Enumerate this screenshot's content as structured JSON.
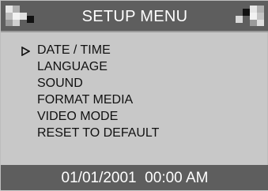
{
  "header": {
    "title": "SETUP MENU",
    "left_icon": "checker-pattern-icon",
    "right_icon": "checker-pattern-icon"
  },
  "menu": {
    "selected_index": 0,
    "cursor_icon": "play-triangle-icon",
    "items": [
      {
        "label": "DATE / TIME"
      },
      {
        "label": "LANGUAGE"
      },
      {
        "label": "SOUND"
      },
      {
        "label": "FORMAT MEDIA"
      },
      {
        "label": "VIDEO MODE"
      },
      {
        "label": "RESET TO DEFAULT"
      }
    ]
  },
  "footer": {
    "date": "01/01/2001",
    "time": "00:00 AM",
    "display": "01/01/2001  00:00 AM"
  },
  "colors": {
    "bar": "#5e5e5e",
    "body": "#c8c8c8",
    "text_light": "#ffffff",
    "text_dark": "#111111"
  }
}
